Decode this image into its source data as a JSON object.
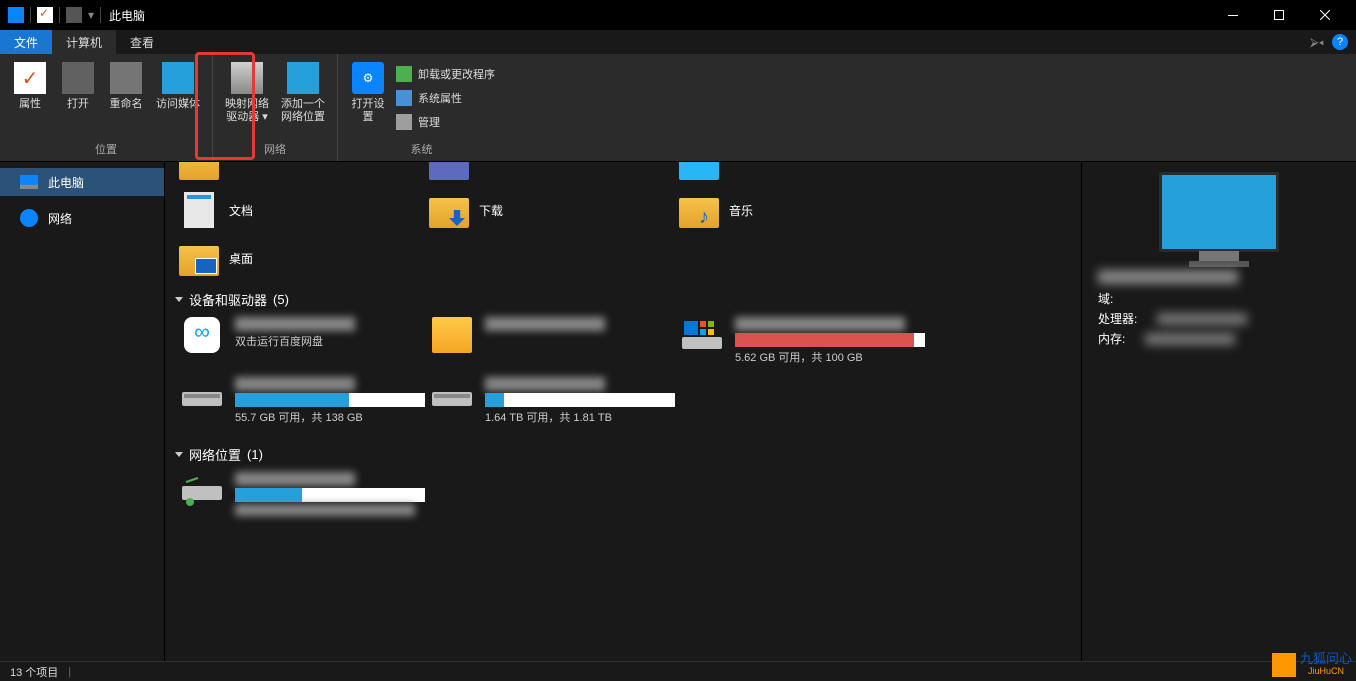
{
  "window": {
    "title": "此电脑"
  },
  "menubar": {
    "file": "文件",
    "computer": "计算机",
    "view": "查看"
  },
  "ribbon": {
    "group_location": {
      "label": "位置",
      "properties": "属性",
      "open": "打开",
      "rename": "重命名",
      "access_media": "访问媒体"
    },
    "group_network": {
      "label": "网络",
      "map_network_drive": "映射网络驱动器",
      "add_network_location": "添加一个网络位置"
    },
    "group_system": {
      "label": "系统",
      "open_settings": "打开设置",
      "uninstall_or_change": "卸载或更改程序",
      "system_properties": "系统属性",
      "manage": "管理"
    }
  },
  "navpane": {
    "this_pc": "此电脑",
    "network": "网络"
  },
  "content": {
    "folders": [
      {
        "id": "docs",
        "label": "文档",
        "type": "doc"
      },
      {
        "id": "downloads",
        "label": "下载",
        "type": "download"
      },
      {
        "id": "music",
        "label": "音乐",
        "type": "music"
      },
      {
        "id": "desktop",
        "label": "桌面",
        "type": "desktop"
      }
    ],
    "section_devices": {
      "label": "设备和驱动器",
      "count": "(5)"
    },
    "drives": {
      "baidu": {
        "subtitle": "双击运行百度网盘"
      },
      "c": {
        "text": "5.62 GB 可用，共 100 GB",
        "fill_pct": 94,
        "full": true
      },
      "d": {
        "text": "55.7 GB 可用，共 138 GB",
        "fill_pct": 60
      },
      "e": {
        "text": "1.64 TB 可用，共 1.81 TB",
        "fill_pct": 10
      }
    },
    "section_network": {
      "label": "网络位置",
      "count": "(1)"
    }
  },
  "preview": {
    "domain_label": "域:",
    "cpu_label": "处理器:",
    "memory_label": "内存:"
  },
  "statusbar": {
    "items": "13 个项目"
  },
  "watermark": {
    "name": "九狐问心",
    "sub": "JiuHuCN"
  }
}
